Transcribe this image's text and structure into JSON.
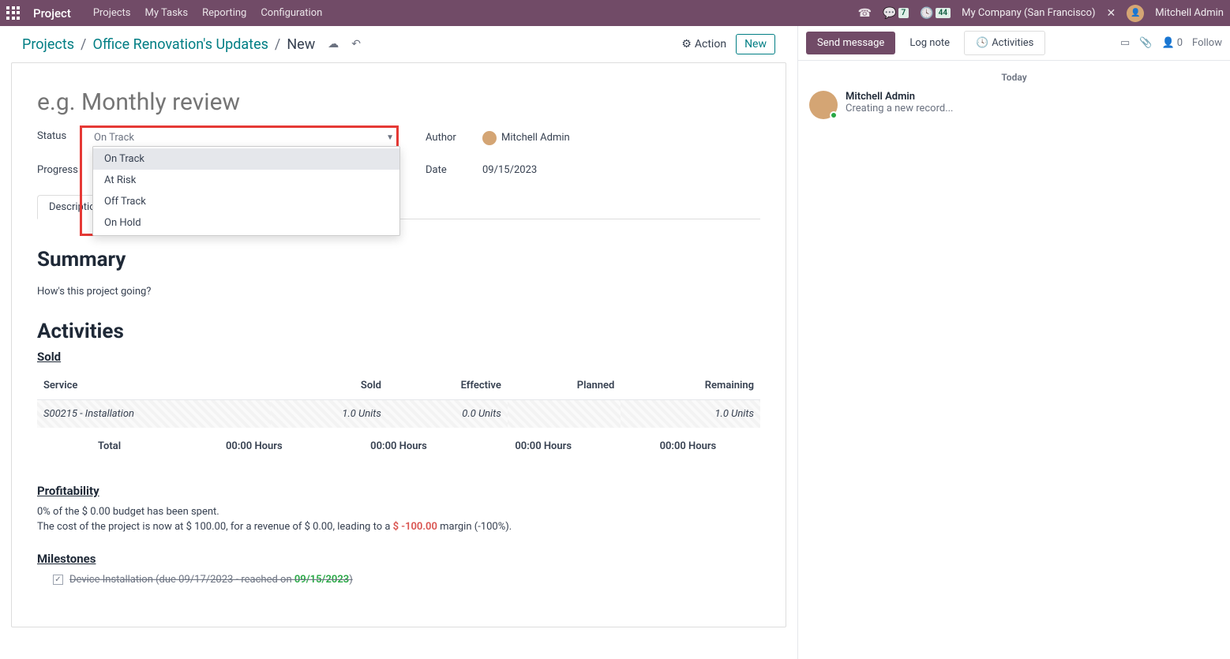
{
  "navbar": {
    "brand": "Project",
    "links": [
      "Projects",
      "My Tasks",
      "Reporting",
      "Configuration"
    ],
    "chat_badge": "7",
    "clock_badge": "44",
    "company": "My Company (San Francisco)",
    "user": "Mitchell Admin"
  },
  "breadcrumb": {
    "root": "Projects",
    "project": "Office Renovation's Updates",
    "current": "New"
  },
  "actions": {
    "action_label": "Action",
    "new_label": "New"
  },
  "form": {
    "title_placeholder": "e.g. Monthly review",
    "labels": {
      "status": "Status",
      "progress": "Progress",
      "author": "Author",
      "date": "Date"
    },
    "status_value": "On Track",
    "status_options": [
      "On Track",
      "At Risk",
      "Off Track",
      "On Hold"
    ],
    "author": "Mitchell Admin",
    "date": "09/15/2023"
  },
  "tabs": {
    "description": "Description"
  },
  "description": {
    "summary_h": "Summary",
    "summary_q": "How's this project going?",
    "activities_h": "Activities",
    "sold_h": "Sold",
    "table": {
      "headers": [
        "Service",
        "Sold",
        "Effective",
        "Planned",
        "Remaining"
      ],
      "row": {
        "service": "S00215 - Installation",
        "sold": "1.0 Units",
        "effective": "0.0 Units",
        "planned": "",
        "remaining": "1.0 Units"
      }
    },
    "totals": {
      "label": "Total",
      "c1": "00:00 Hours",
      "c2": "00:00 Hours",
      "c3": "00:00 Hours",
      "c4": "00:00 Hours"
    },
    "profit_h": "Profitability",
    "profit_line1_a": "0% of the $ 0.00 budget has been spent.",
    "profit_line2_a": "The cost of the project is now at $ 100.00, for a revenue of $ 0.00, leading to a ",
    "profit_line2_b": "$ -100.00",
    "profit_line2_c": " margin (-100%).",
    "milestones_h": "Milestones",
    "milestone_a": "Device Installation (due 09/17/2023 - reached on ",
    "milestone_b": "09/15/2023",
    "milestone_c": ")"
  },
  "chatter": {
    "send": "Send message",
    "log": "Log note",
    "activities": "Activities",
    "follower_count": "0",
    "follow": "Follow",
    "today": "Today",
    "message": {
      "author": "Mitchell Admin",
      "text": "Creating a new record..."
    }
  }
}
